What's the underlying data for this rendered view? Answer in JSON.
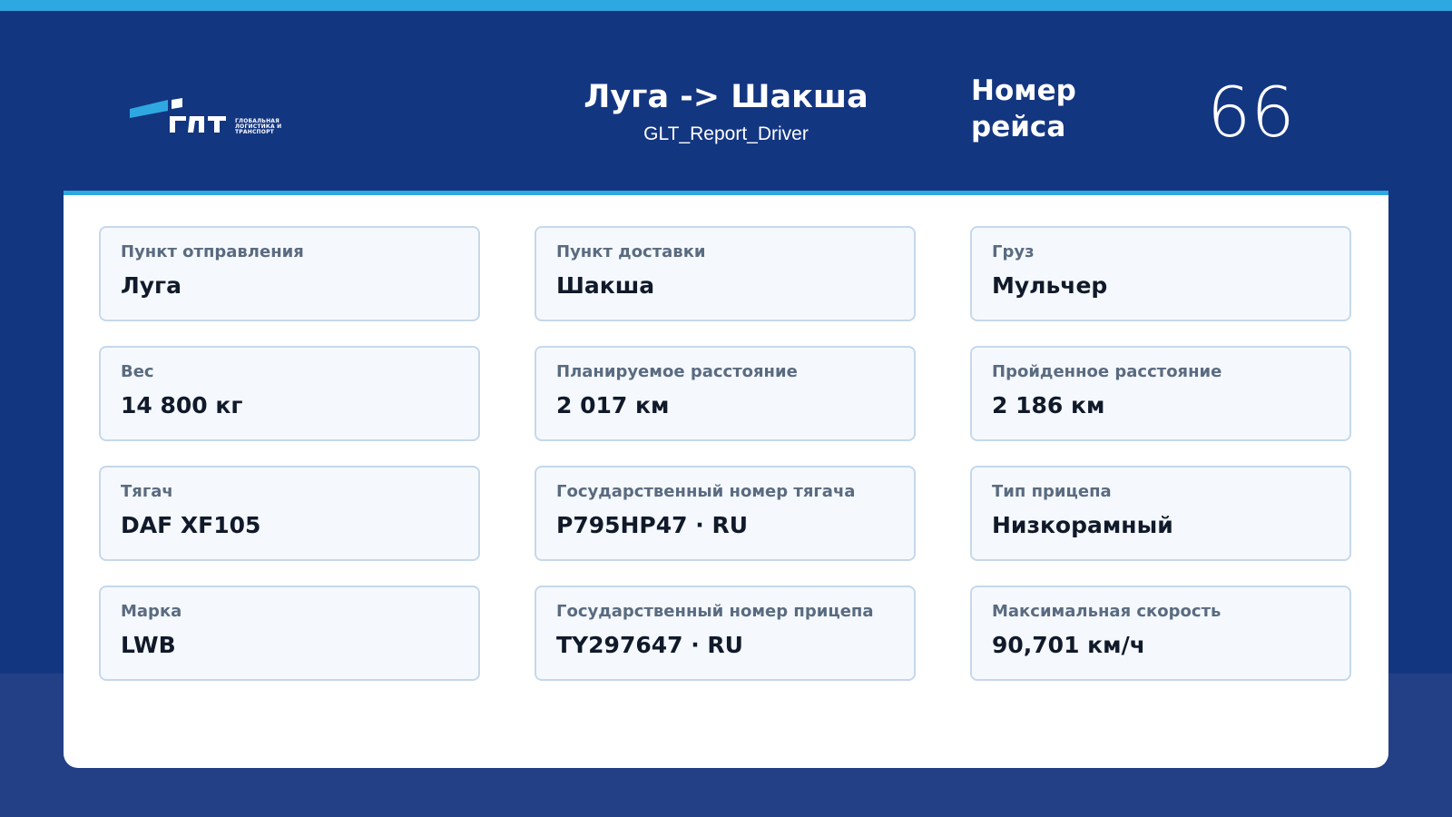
{
  "logo": {
    "brand": "ГЛТ",
    "tagline": "Глобальная логистика и транспорт",
    "color_light": "#2ea8e0",
    "color_text": "#ffffff"
  },
  "header": {
    "route": "Луга -> Шакша",
    "report_name": "GLT_Report_Driver",
    "trip_label": "Номер рейса",
    "trip_number": "66"
  },
  "colors": {
    "header_bg": "#133681",
    "page_bg": "#233f86",
    "accent": "#2ea8e0",
    "card_bg": "#f5f9fe",
    "card_border": "#c6d8ea"
  },
  "cards": [
    {
      "label": "Пункт отправления",
      "value": "Луга"
    },
    {
      "label": "Пункт доставки",
      "value": "Шакша"
    },
    {
      "label": "Груз",
      "value": "Мульчер"
    },
    {
      "label": "Вес",
      "value": "14 800 кг"
    },
    {
      "label": "Планируемое расстояние",
      "value": "2 017 км"
    },
    {
      "label": "Пройденное расстояние",
      "value": "2 186 км"
    },
    {
      "label": "Тягач",
      "value": "DAF XF105"
    },
    {
      "label": "Государственный номер тягача",
      "value": "P795HP47 · RU"
    },
    {
      "label": "Тип прицепа",
      "value": "Низкорамный"
    },
    {
      "label": "Марка",
      "value": "LWB"
    },
    {
      "label": "Государственный номер прицепа",
      "value": "TY297647 · RU"
    },
    {
      "label": "Максимальная скорость",
      "value": "90,701 км/ч"
    }
  ]
}
